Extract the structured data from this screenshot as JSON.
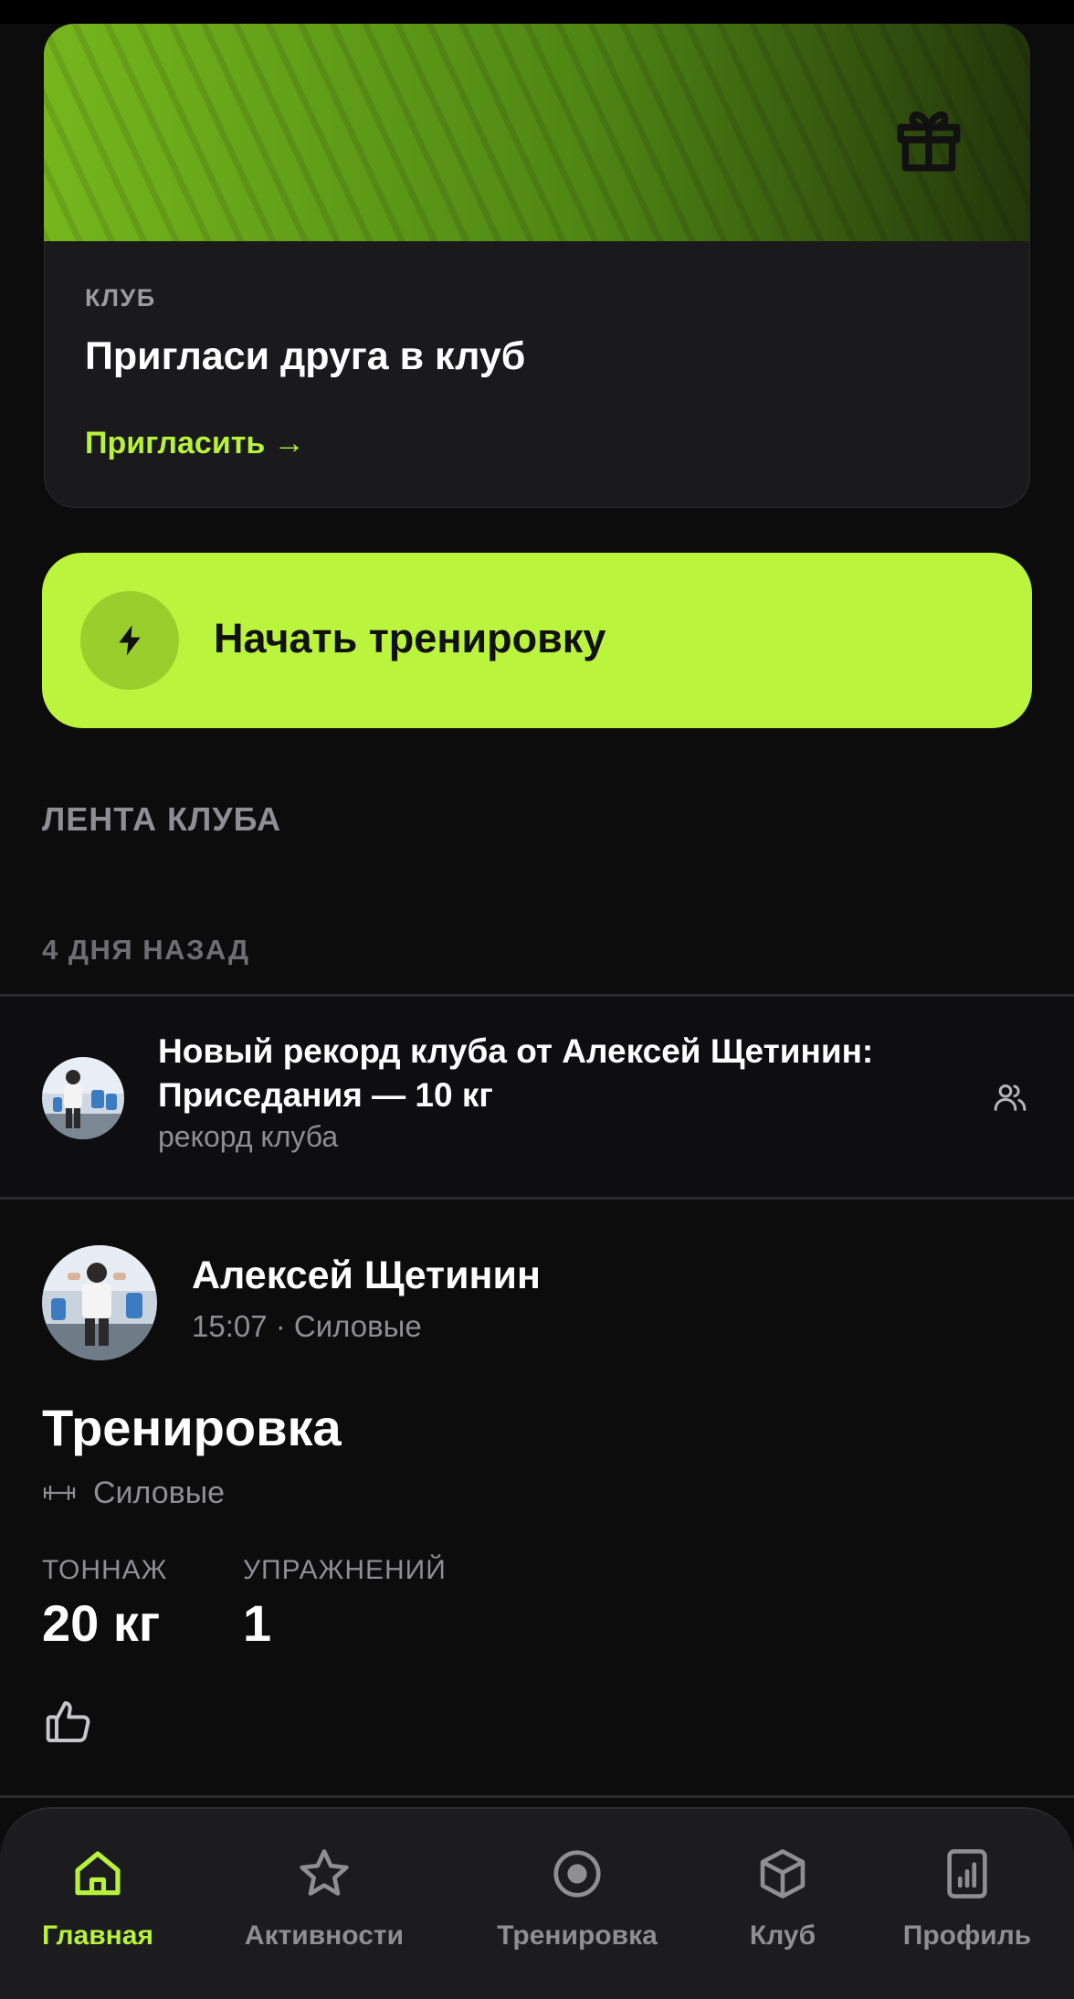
{
  "invite_card": {
    "kicker": "КЛУБ",
    "title": "Пригласи друга в клуб",
    "link_label": "Пригласить →",
    "icon": "gift-icon"
  },
  "start_workout": {
    "label": "Начать тренировку",
    "icon": "lightning-icon"
  },
  "feed": {
    "section_title": "ЛЕНТА КЛУБА",
    "date_label": "4 ДНЯ НАЗАД",
    "record": {
      "title": "Новый рекорд клуба от Алексей Щетинин: Приседания — 10 кг",
      "subtitle": "рекорд клуба",
      "icon": "people-icon"
    },
    "post": {
      "author": "Алексей Щетинин",
      "meta": "15:07 · Силовые",
      "title": "Тренировка",
      "type_label": "Силовые",
      "type_icon": "dumbbell-icon",
      "stats": [
        {
          "label": "ТОННАЖ",
          "value": "20 кг"
        },
        {
          "label": "УПРАЖНЕНИЙ",
          "value": "1"
        }
      ],
      "like_icon": "thumbs-up-icon"
    }
  },
  "tabbar": {
    "active": "home",
    "tabs": [
      {
        "id": "home",
        "label": "Главная",
        "icon": "home-icon"
      },
      {
        "id": "activities",
        "label": "Активности",
        "icon": "star-icon"
      },
      {
        "id": "workout",
        "label": "Тренировка",
        "icon": "target-icon"
      },
      {
        "id": "club",
        "label": "Клуб",
        "icon": "cube-icon"
      },
      {
        "id": "profile",
        "label": "Профиль",
        "icon": "chart-icon"
      }
    ]
  },
  "colors": {
    "accent": "#b8f23a",
    "button": "#bbf43d",
    "background": "#0c0c0d",
    "card": "#1a1a1c",
    "muted": "#8e8e93"
  }
}
